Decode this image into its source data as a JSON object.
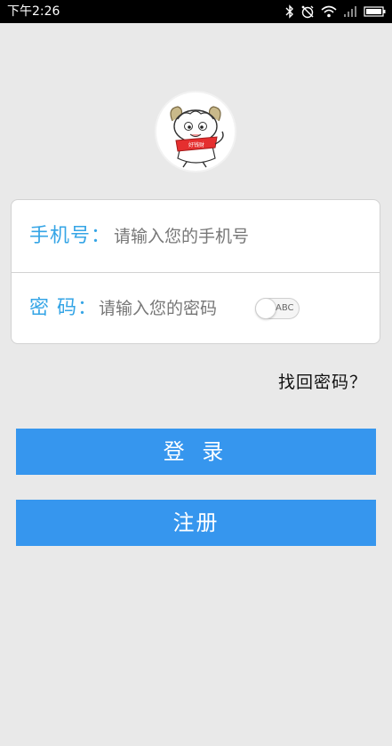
{
  "status_bar": {
    "time": "下午2:26",
    "icons": [
      "bluetooth-icon",
      "alarm-off-icon",
      "wifi-icon",
      "signal-icon",
      "battery-icon"
    ]
  },
  "avatar": {
    "badge_text": "好钱财"
  },
  "form": {
    "phone_label": "手机号：",
    "phone_placeholder": "请输入您的手机号",
    "password_label": "密 码：",
    "password_placeholder": "请输入您的密码",
    "toggle_text": "ABC"
  },
  "forgot_password": "找回密码？",
  "buttons": {
    "login": "登 录",
    "register": "注册"
  },
  "colors": {
    "accent": "#35a5e6",
    "button": "#3696ee",
    "background": "#e9e9e9"
  }
}
